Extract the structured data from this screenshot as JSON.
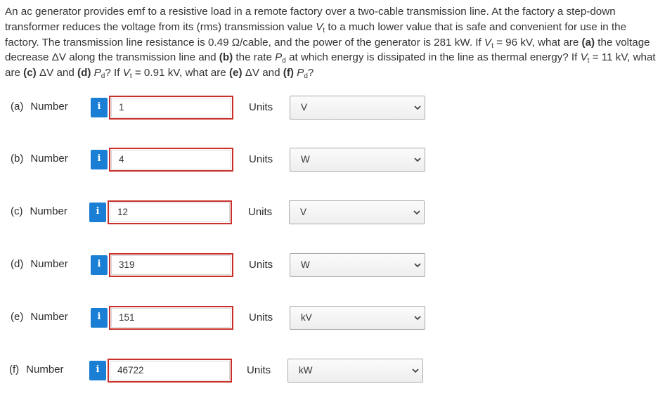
{
  "question": {
    "t1": "An ac generator provides emf to a resistive load in a remote factory over a two-cable transmission line. At the factory a step-down transformer reduces the voltage from its (rms) transmission value ",
    "vt": "V",
    "vt_sub": "t",
    "t2": " to a much lower value that is safe and convenient for use in the factory. The transmission line resistance is 0.49 Ω/cable, and the power of the generator is 281 kW. If ",
    "t3": " = 96 kV, what are ",
    "pa": "(a)",
    "t4": " the voltage decrease ΔV along the transmission line and ",
    "pb": "(b)",
    "t5": " the rate ",
    "pd": "P",
    "pd_sub": "d",
    "t6": " at which energy is dissipated in the line as thermal energy? If ",
    "t7": " = 11 kV, what are ",
    "pc": "(c)",
    "t8": " ΔV and ",
    "pdd": "(d)",
    "t9": "? If ",
    "t10": " = 0.91 kV, what are ",
    "pe": "(e)",
    "t11": " ΔV and ",
    "pf": "(f)",
    "t12": "?"
  },
  "rows": [
    {
      "part": "(a)",
      "number_label": "Number",
      "info": "i",
      "value": "1",
      "units_label": "Units",
      "unit": "V"
    },
    {
      "part": "(b)",
      "number_label": "Number",
      "info": "i",
      "value": "4",
      "units_label": "Units",
      "unit": "W"
    },
    {
      "part": "(c)",
      "number_label": "Number",
      "info": "i",
      "value": "12",
      "units_label": "Units",
      "unit": "V"
    },
    {
      "part": "(d)",
      "number_label": "Number",
      "info": "i",
      "value": "319",
      "units_label": "Units",
      "unit": "W"
    },
    {
      "part": "(e)",
      "number_label": "Number",
      "info": "i",
      "value": "151",
      "units_label": "Units",
      "unit": "kV"
    },
    {
      "part": "(f)",
      "number_label": "Number",
      "info": "i",
      "value": "46722",
      "units_label": "Units",
      "unit": "kW"
    }
  ],
  "colors": {
    "info_button": "#1a7fd4",
    "answer_border_incorrect": "#c9302c"
  },
  "icons": {
    "info": "info-icon",
    "dropdown": "chevron-down-icon"
  }
}
